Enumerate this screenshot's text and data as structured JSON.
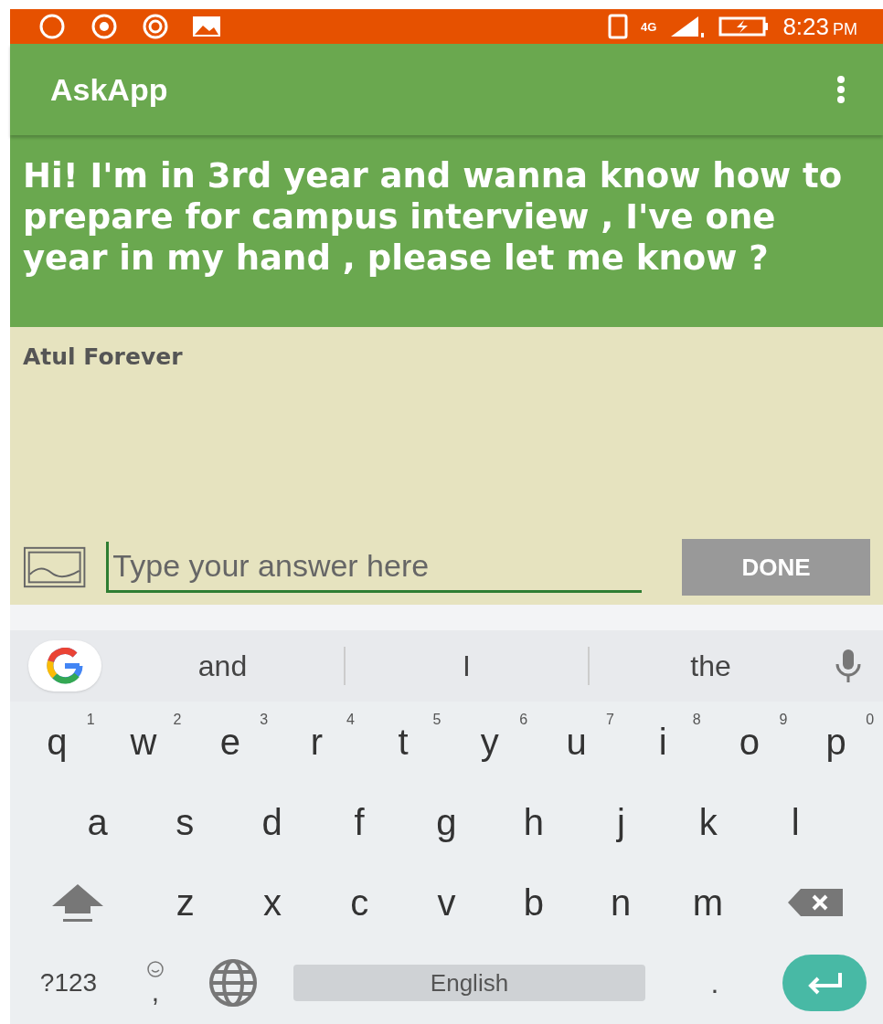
{
  "status_bar": {
    "network": "4G",
    "time": "8:23",
    "ampm": "PM"
  },
  "app_bar": {
    "title": "AskApp"
  },
  "question": {
    "text": "Hi! I'm in 3rd year and wanna know how to prepare for campus interview , I've one year in my hand , please let me know ?",
    "author": "Atul Forever"
  },
  "answer": {
    "placeholder": "Type your answer here",
    "button": "DONE"
  },
  "keyboard": {
    "suggestions": [
      "and",
      "I",
      "the"
    ],
    "row_1": [
      {
        "label": "q",
        "hint": "1"
      },
      {
        "label": "w",
        "hint": "2"
      },
      {
        "label": "e",
        "hint": "3"
      },
      {
        "label": "r",
        "hint": "4"
      },
      {
        "label": "t",
        "hint": "5"
      },
      {
        "label": "y",
        "hint": "6"
      },
      {
        "label": "u",
        "hint": "7"
      },
      {
        "label": "i",
        "hint": "8"
      },
      {
        "label": "o",
        "hint": "9"
      },
      {
        "label": "p",
        "hint": "0"
      }
    ],
    "row_2": [
      "a",
      "s",
      "d",
      "f",
      "g",
      "h",
      "j",
      "k",
      "l"
    ],
    "row_3": [
      "z",
      "x",
      "c",
      "v",
      "b",
      "n",
      "m"
    ],
    "symbols_key": "?123",
    "comma_key": ",",
    "space_key": "English",
    "period_key": "."
  }
}
